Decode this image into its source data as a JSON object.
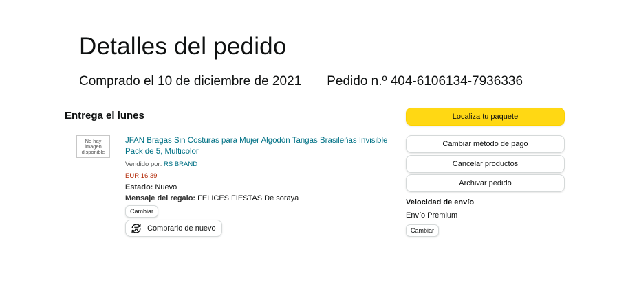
{
  "header": {
    "title": "Detalles del pedido",
    "purchased": "Comprado el 10 de diciembre de 2021",
    "order_number": "Pedido n.º 404-6106134-7936336"
  },
  "shipment": {
    "heading": "Entrega el lunes"
  },
  "item": {
    "thumbnail_text": "No hay imagen disponible",
    "title": "JFAN Bragas Sin Costuras para Mujer Algodón Tangas Brasileñas Invisible Pack de 5, Multicolor",
    "sold_by_label": "Vendido por:",
    "seller": "RS BRAND",
    "price": "EUR 16,39",
    "condition_label": "Estado:",
    "condition": "Nuevo",
    "gift_label": "Mensaje del regalo:",
    "gift_message": "FELICES FIESTAS De soraya",
    "change_label": "Cambiar",
    "buy_again_label": "Comprarlo de nuevo",
    "buy_again_icon": "reorder-icon"
  },
  "actions": {
    "track": "Localiza tu paquete",
    "change_payment": "Cambiar método de pago",
    "cancel": "Cancelar productos",
    "archive": "Archivar pedido"
  },
  "shipping_speed": {
    "heading": "Velocidad de envío",
    "value": "Envío Premium",
    "change_label": "Cambiar"
  },
  "colors": {
    "primary_button": "#ffd814",
    "link": "#007185",
    "price": "#b12704",
    "text": "#0f1111"
  }
}
